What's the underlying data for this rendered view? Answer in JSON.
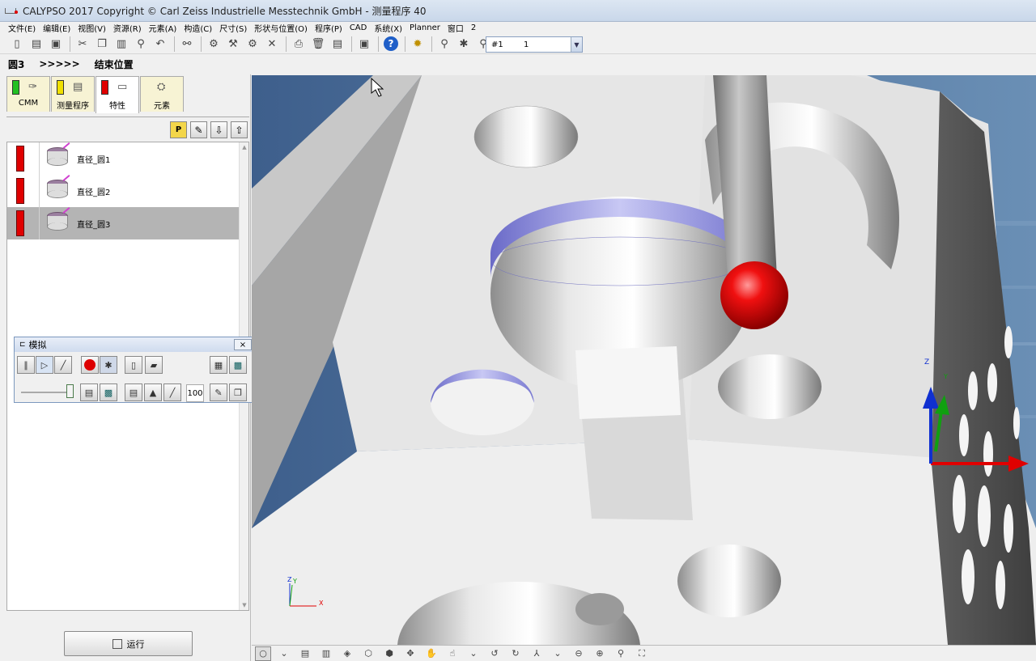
{
  "window": {
    "title": "CALYPSO 2017 Copyright © Carl Zeiss Industrielle Messtechnik GmbH - 测量程序 40"
  },
  "menu": [
    "文件(E)",
    "编辑(E)",
    "视图(V)",
    "资源(R)",
    "元素(A)",
    "构造(C)",
    "尺寸(S)",
    "形状与位置(O)",
    "程序(P)",
    "CAD",
    "系统(X)",
    "Planner",
    "窗口",
    "2"
  ],
  "toolbar": {
    "combo_left": "#1",
    "combo_right": "1",
    "help": "?"
  },
  "status": {
    "feature": "圆3",
    "arrows": ">>>>>",
    "position": "结束位置"
  },
  "tabs": [
    {
      "label": "CMM",
      "flag": "#22c022"
    },
    {
      "label": "测量程序",
      "flag": "#f0e000"
    },
    {
      "label": "特性",
      "flag": "#e00000"
    },
    {
      "label": "元素",
      "flag": ""
    }
  ],
  "feature_toolbar": {
    "p_button": "P"
  },
  "features": [
    {
      "label": "直径_圆1",
      "status_color": "#e00000"
    },
    {
      "label": "直径_圆2",
      "status_color": "#e00000"
    },
    {
      "label": "直径_圆3",
      "status_color": "#e00000"
    }
  ],
  "simulation": {
    "title": "模拟",
    "close": "×",
    "speed": "100"
  },
  "run_button": {
    "label": "运行"
  },
  "viewport": {
    "axis_large": {
      "z": "Z",
      "y": "Y"
    },
    "axis_small": {
      "z": "Z",
      "y": "Y",
      "x": "X"
    }
  }
}
